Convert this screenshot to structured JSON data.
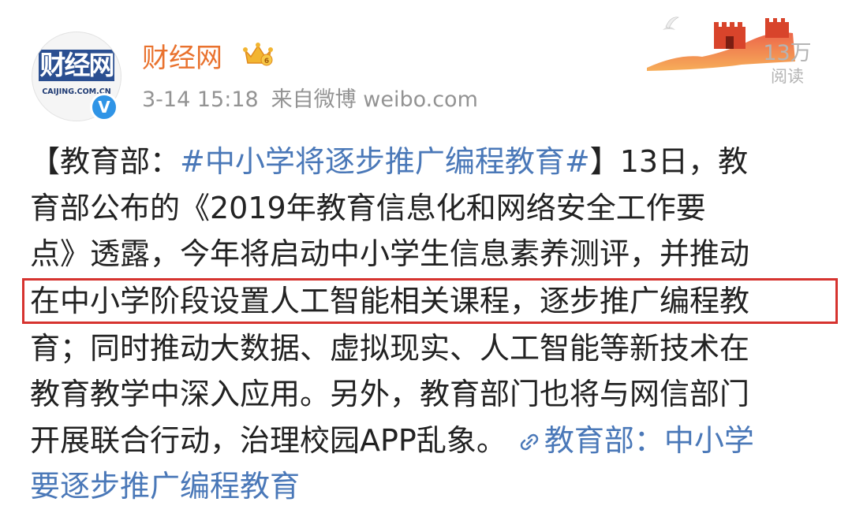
{
  "account": {
    "name": "财经网",
    "avatar_logo": "财经网",
    "avatar_domain": "CAIJING.COM.CN",
    "verified_badge": "V",
    "vip_icon": "crown-icon"
  },
  "post_meta": {
    "date": "3-14 15:18",
    "source": "来自微博 weibo.com"
  },
  "stats": {
    "read_count": "13万",
    "read_label": "阅读"
  },
  "post": {
    "bracket_open": "【",
    "prefix": "教育部：",
    "topic": "#中小学将逐步推广编程教育#",
    "line1_tail": "】13日，教",
    "line2": "育部公布的《2019年教育信息化和网络安全工作要",
    "line3": "点》透露，今年将启动中小学生信息素养测评，并推动",
    "line4_highlight": "在中小学阶段设置人工智能相关课程，逐步推广编程教",
    "line5": "育；同时推动大数据、虚拟现实、人工智能等新技术在",
    "line6": "教育教学中深入应用。另外，教育部门也将与网信部门",
    "line7_text": "开展联合行动，治理校园APP乱象。",
    "link_icon": "link-icon",
    "link_part1": "教育部：中小学",
    "link_part2": "要逐步推广编程教育"
  },
  "colors": {
    "name": "#e9722e",
    "topic_link": "#4a78b8",
    "highlight_border": "#d6332f",
    "meta_gray": "#939393",
    "verified_blue": "#2f94e6"
  }
}
